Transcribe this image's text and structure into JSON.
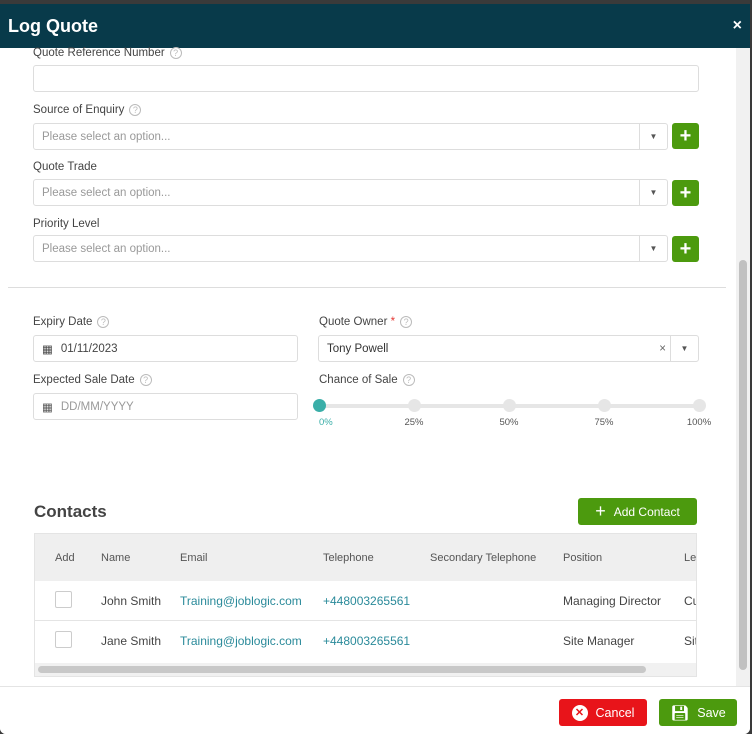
{
  "modal": {
    "title": "Log Quote",
    "close": "×"
  },
  "fields": {
    "quote_ref": {
      "label": "Quote Reference Number",
      "value": ""
    },
    "source": {
      "label": "Source of Enquiry",
      "placeholder": "Please select an option..."
    },
    "trade": {
      "label": "Quote Trade",
      "placeholder": "Please select an option..."
    },
    "priority": {
      "label": "Priority Level",
      "placeholder": "Please select an option..."
    },
    "expiry": {
      "label": "Expiry Date",
      "value": "01/11/2023"
    },
    "owner": {
      "label": "Quote Owner",
      "required": "*",
      "value": "Tony Powell"
    },
    "sale_date": {
      "label": "Expected Sale Date",
      "placeholder": "DD/MM/YYYY"
    },
    "chance": {
      "label": "Chance of Sale",
      "value_percent": 0,
      "ticks": [
        "0%",
        "25%",
        "50%",
        "75%",
        "100%"
      ]
    }
  },
  "contacts": {
    "title": "Contacts",
    "add_label": "Add Contact",
    "columns": [
      "Add",
      "Name",
      "Email",
      "Telephone",
      "Secondary Telephone",
      "Position",
      "Le"
    ],
    "rows": [
      {
        "name": "John Smith",
        "email": "Training@joblogic.com",
        "telephone": "+448003265561",
        "secondary": "",
        "position": "Managing Director",
        "extra": "Cu"
      },
      {
        "name": "Jane Smith",
        "email": "Training@joblogic.com",
        "telephone": "+448003265561",
        "secondary": "",
        "position": "Site Manager",
        "extra": "Sit"
      }
    ]
  },
  "footer": {
    "cancel": "Cancel",
    "save": "Save"
  },
  "colors": {
    "header": "#083a4a",
    "primary": "#4c9a0e",
    "danger": "#e8141a",
    "accent": "#3aaea8"
  }
}
